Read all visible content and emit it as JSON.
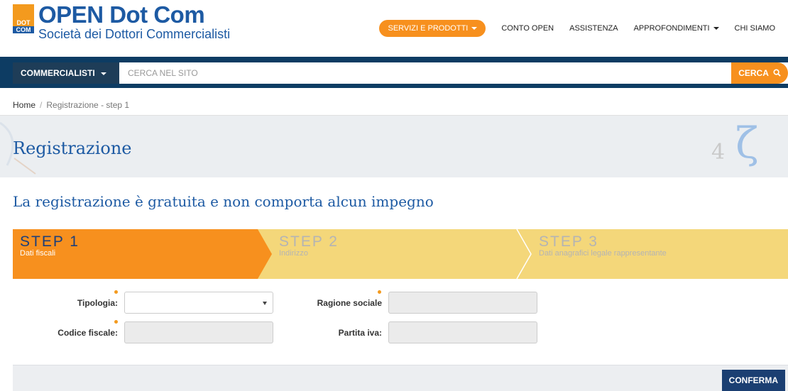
{
  "brand": {
    "title": "OPEN Dot Com",
    "subtitle": "Società dei Dottori Commercialisti",
    "mark_top": "DOT",
    "mark_bottom": "COM"
  },
  "topnav": {
    "servizi_label": "SERVIZI E PRODOTTI",
    "items": [
      "CONTO OPEN",
      "ASSISTENZA",
      "APPROFONDIMENTI",
      "CHI SIAMO"
    ]
  },
  "search": {
    "category_label": "COMMERCIALISTI",
    "placeholder": "CERCA NEL SITO",
    "button_label": "CERCA"
  },
  "breadcrumb": {
    "home": "Home",
    "separator": "/",
    "current": "Registrazione - step 1"
  },
  "page": {
    "title": "Registrazione",
    "subtitle": "La registrazione è gratuita e non comporta alcun impegno"
  },
  "steps": [
    {
      "label": "STEP 1",
      "desc": "Dati fiscali",
      "active": true
    },
    {
      "label": "STEP 2",
      "desc": "Indirizzo",
      "active": false
    },
    {
      "label": "STEP 3",
      "desc": "Dati anagrafici legale rappresentante",
      "active": false
    }
  ],
  "form": {
    "tipologia_label": "Tipologia:",
    "tipologia_value": "",
    "codice_fiscale_label": "Codice fiscale:",
    "ragione_sociale_label": "Ragione sociale",
    "partita_iva_label": "Partita iva:"
  },
  "actions": {
    "confirm_label": "CONFERMA"
  },
  "colors": {
    "brand_blue": "#1d5aa3",
    "orange": "#f7901e",
    "step_active": "#f7901e",
    "step_inactive": "#f4d77a",
    "navy": "#0d3c63"
  }
}
